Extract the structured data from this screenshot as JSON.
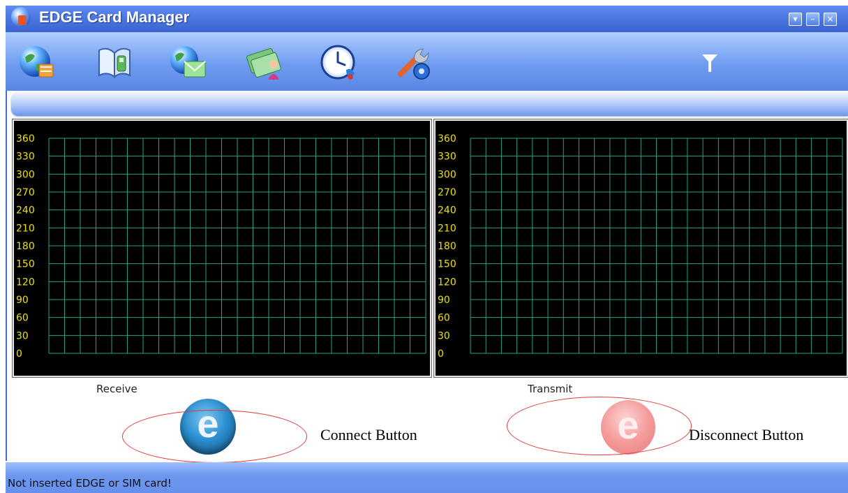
{
  "window": {
    "title": "EDGE Card Manager",
    "controls": {
      "menu": "▾",
      "minimize": "–",
      "close": "×"
    }
  },
  "toolbar": {
    "items": [
      {
        "icon": "internet-connect-icon"
      },
      {
        "icon": "phonebook-icon"
      },
      {
        "icon": "sms-icon"
      },
      {
        "icon": "contacts-icon"
      },
      {
        "icon": "call-history-icon"
      },
      {
        "icon": "settings-icon"
      }
    ],
    "signal_icon": "signal-strength-icon"
  },
  "graphs": {
    "receive": {
      "caption": "Receive",
      "y_ticks": [
        "360",
        "330",
        "300",
        "270",
        "240",
        "210",
        "180",
        "150",
        "120",
        "90",
        "60",
        "30",
        "0"
      ]
    },
    "transmit": {
      "caption": "Transmit",
      "y_ticks": [
        "360",
        "330",
        "300",
        "270",
        "240",
        "210",
        "180",
        "150",
        "120",
        "90",
        "60",
        "30",
        "0"
      ]
    }
  },
  "buttons": {
    "connect_glyph": "e",
    "disconnect_glyph": "e"
  },
  "annotations": {
    "connect": "Connect Button",
    "disconnect": "Disconnect Button"
  },
  "status": {
    "text": "Not inserted EDGE or SIM card!"
  },
  "colors": {
    "titlebar": "#4b78e2",
    "toolbar": "#6f9cf0",
    "grid_line": "#2aa088",
    "tick_text": "#f0e000",
    "annotation_ellipse": "#e23a3a"
  }
}
